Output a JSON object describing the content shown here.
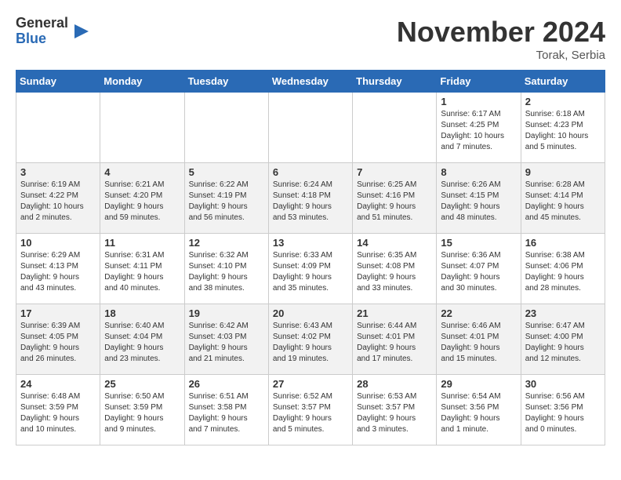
{
  "logo": {
    "general": "General",
    "blue": "Blue"
  },
  "header": {
    "month": "November 2024",
    "location": "Torak, Serbia"
  },
  "weekdays": [
    "Sunday",
    "Monday",
    "Tuesday",
    "Wednesday",
    "Thursday",
    "Friday",
    "Saturday"
  ],
  "weeks": [
    [
      {
        "day": "",
        "info": ""
      },
      {
        "day": "",
        "info": ""
      },
      {
        "day": "",
        "info": ""
      },
      {
        "day": "",
        "info": ""
      },
      {
        "day": "",
        "info": ""
      },
      {
        "day": "1",
        "info": "Sunrise: 6:17 AM\nSunset: 4:25 PM\nDaylight: 10 hours\nand 7 minutes."
      },
      {
        "day": "2",
        "info": "Sunrise: 6:18 AM\nSunset: 4:23 PM\nDaylight: 10 hours\nand 5 minutes."
      }
    ],
    [
      {
        "day": "3",
        "info": "Sunrise: 6:19 AM\nSunset: 4:22 PM\nDaylight: 10 hours\nand 2 minutes."
      },
      {
        "day": "4",
        "info": "Sunrise: 6:21 AM\nSunset: 4:20 PM\nDaylight: 9 hours\nand 59 minutes."
      },
      {
        "day": "5",
        "info": "Sunrise: 6:22 AM\nSunset: 4:19 PM\nDaylight: 9 hours\nand 56 minutes."
      },
      {
        "day": "6",
        "info": "Sunrise: 6:24 AM\nSunset: 4:18 PM\nDaylight: 9 hours\nand 53 minutes."
      },
      {
        "day": "7",
        "info": "Sunrise: 6:25 AM\nSunset: 4:16 PM\nDaylight: 9 hours\nand 51 minutes."
      },
      {
        "day": "8",
        "info": "Sunrise: 6:26 AM\nSunset: 4:15 PM\nDaylight: 9 hours\nand 48 minutes."
      },
      {
        "day": "9",
        "info": "Sunrise: 6:28 AM\nSunset: 4:14 PM\nDaylight: 9 hours\nand 45 minutes."
      }
    ],
    [
      {
        "day": "10",
        "info": "Sunrise: 6:29 AM\nSunset: 4:13 PM\nDaylight: 9 hours\nand 43 minutes."
      },
      {
        "day": "11",
        "info": "Sunrise: 6:31 AM\nSunset: 4:11 PM\nDaylight: 9 hours\nand 40 minutes."
      },
      {
        "day": "12",
        "info": "Sunrise: 6:32 AM\nSunset: 4:10 PM\nDaylight: 9 hours\nand 38 minutes."
      },
      {
        "day": "13",
        "info": "Sunrise: 6:33 AM\nSunset: 4:09 PM\nDaylight: 9 hours\nand 35 minutes."
      },
      {
        "day": "14",
        "info": "Sunrise: 6:35 AM\nSunset: 4:08 PM\nDaylight: 9 hours\nand 33 minutes."
      },
      {
        "day": "15",
        "info": "Sunrise: 6:36 AM\nSunset: 4:07 PM\nDaylight: 9 hours\nand 30 minutes."
      },
      {
        "day": "16",
        "info": "Sunrise: 6:38 AM\nSunset: 4:06 PM\nDaylight: 9 hours\nand 28 minutes."
      }
    ],
    [
      {
        "day": "17",
        "info": "Sunrise: 6:39 AM\nSunset: 4:05 PM\nDaylight: 9 hours\nand 26 minutes."
      },
      {
        "day": "18",
        "info": "Sunrise: 6:40 AM\nSunset: 4:04 PM\nDaylight: 9 hours\nand 23 minutes."
      },
      {
        "day": "19",
        "info": "Sunrise: 6:42 AM\nSunset: 4:03 PM\nDaylight: 9 hours\nand 21 minutes."
      },
      {
        "day": "20",
        "info": "Sunrise: 6:43 AM\nSunset: 4:02 PM\nDaylight: 9 hours\nand 19 minutes."
      },
      {
        "day": "21",
        "info": "Sunrise: 6:44 AM\nSunset: 4:01 PM\nDaylight: 9 hours\nand 17 minutes."
      },
      {
        "day": "22",
        "info": "Sunrise: 6:46 AM\nSunset: 4:01 PM\nDaylight: 9 hours\nand 15 minutes."
      },
      {
        "day": "23",
        "info": "Sunrise: 6:47 AM\nSunset: 4:00 PM\nDaylight: 9 hours\nand 12 minutes."
      }
    ],
    [
      {
        "day": "24",
        "info": "Sunrise: 6:48 AM\nSunset: 3:59 PM\nDaylight: 9 hours\nand 10 minutes."
      },
      {
        "day": "25",
        "info": "Sunrise: 6:50 AM\nSunset: 3:59 PM\nDaylight: 9 hours\nand 9 minutes."
      },
      {
        "day": "26",
        "info": "Sunrise: 6:51 AM\nSunset: 3:58 PM\nDaylight: 9 hours\nand 7 minutes."
      },
      {
        "day": "27",
        "info": "Sunrise: 6:52 AM\nSunset: 3:57 PM\nDaylight: 9 hours\nand 5 minutes."
      },
      {
        "day": "28",
        "info": "Sunrise: 6:53 AM\nSunset: 3:57 PM\nDaylight: 9 hours\nand 3 minutes."
      },
      {
        "day": "29",
        "info": "Sunrise: 6:54 AM\nSunset: 3:56 PM\nDaylight: 9 hours\nand 1 minute."
      },
      {
        "day": "30",
        "info": "Sunrise: 6:56 AM\nSunset: 3:56 PM\nDaylight: 9 hours\nand 0 minutes."
      }
    ]
  ]
}
